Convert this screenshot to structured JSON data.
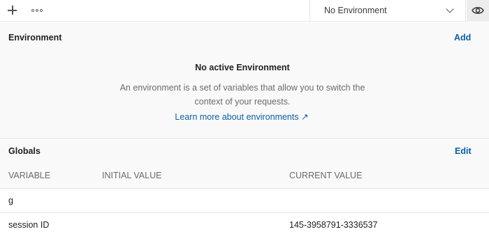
{
  "toolbar": {
    "add_icon": "plus-icon",
    "more_icon": "more-horizontal-icon",
    "environment_selector": "No Environment",
    "chevron_icon": "chevron-down-icon",
    "quick_look_icon": "eye-icon"
  },
  "environment_section": {
    "title": "Environment",
    "action": "Add",
    "empty_title": "No active Environment",
    "empty_description": "An environment is a set of variables that allow you to switch the context of your requests.",
    "learn_more": "Learn more about environments ↗"
  },
  "globals_section": {
    "title": "Globals",
    "action": "Edit",
    "columns": [
      "VARIABLE",
      "INITIAL VALUE",
      "CURRENT VALUE"
    ],
    "rows": [
      {
        "variable": "g",
        "initial_value": "",
        "current_value": ""
      },
      {
        "variable": "session ID",
        "initial_value": "",
        "current_value": "145-3958791-3336537"
      }
    ]
  },
  "colors": {
    "link": "#0b5fa8",
    "panel_background": "#f9f9f9",
    "border": "#e6e6e6"
  }
}
